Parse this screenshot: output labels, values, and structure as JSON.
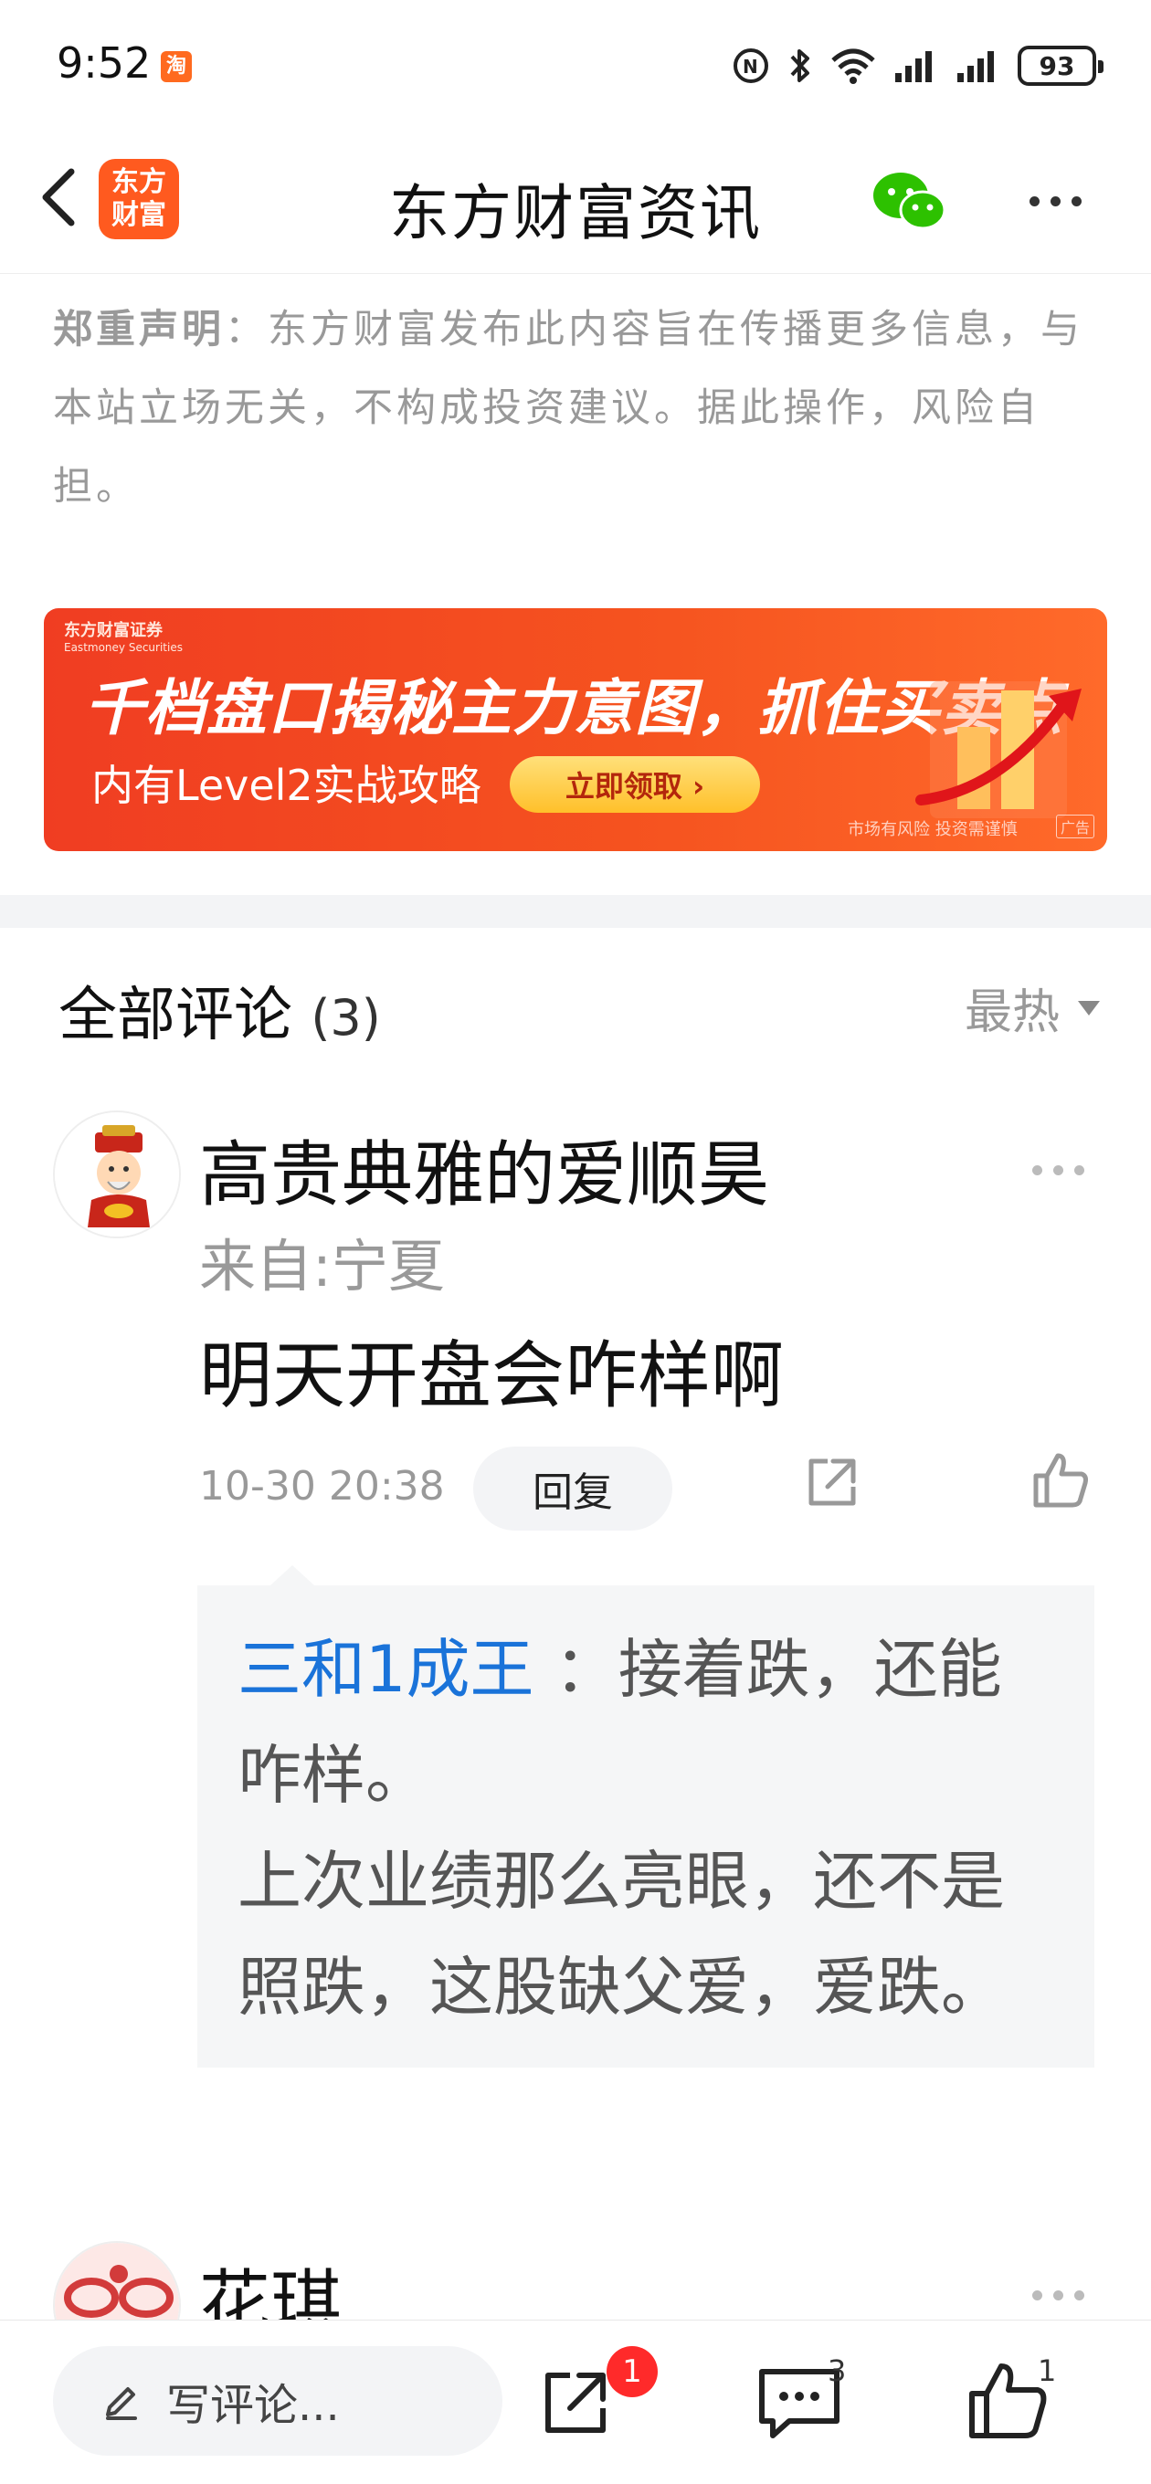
{
  "status_bar": {
    "time": "9:52",
    "app_badge": "淘",
    "battery": "93"
  },
  "header": {
    "logo_line1": "东方",
    "logo_line2": "财富",
    "title": "东方财富资讯"
  },
  "disclaimer": {
    "label": "郑重声明",
    "text": "：东方财富发布此内容旨在传播更多信息，与本站立场无关，不构成投资建议。据此操作，风险自担。"
  },
  "ad": {
    "brand": "东方财富证券",
    "brand_en": "Eastmoney Securities",
    "headline": "千档盘口揭秘主力意图，抓住买卖点",
    "sub": "内有Level2实战攻略",
    "cta": "立即领取 ›",
    "risk": "市场有风险 投资需谨慎",
    "tag": "广告"
  },
  "comments_header": {
    "title": "全部评论",
    "count": "(3)",
    "sort": "最热"
  },
  "comments": [
    {
      "user": "高贵典雅的爱顺昊",
      "location": "来自:宁夏",
      "text": "明天开盘会咋样啊",
      "time": "10-30 20:38",
      "reply_label": "回复",
      "reply": {
        "user": "三和1成王",
        "text": " ：接着跌，还能咋样。",
        "text2": "上次业绩那么亮眼，还不是照跌，这股缺父爱，爱跌。"
      }
    },
    {
      "user": "花琪"
    }
  ],
  "bottom_bar": {
    "write_placeholder": "写评论...",
    "share_badge": "1",
    "comment_count": "3",
    "like_count": "1"
  },
  "colors": {
    "brand_orange": "#ff5a1f",
    "link_blue": "#1a73d9",
    "wechat_green": "#2dc100",
    "badge_red": "#ff2a2a"
  }
}
